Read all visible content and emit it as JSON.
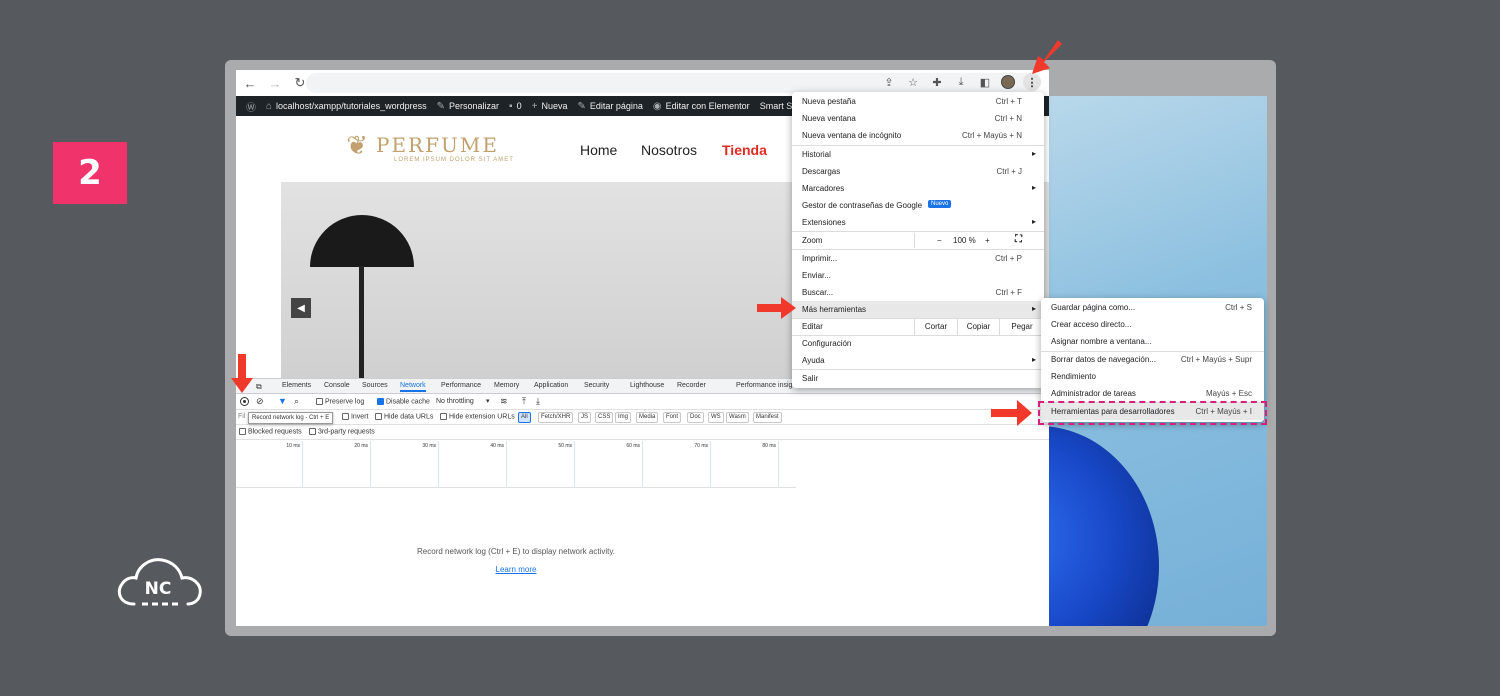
{
  "step_number": "2",
  "brand_logo": "NC",
  "browser": {
    "wp_admin_bar": {
      "site": "localhost/xampp/tutoriales_wordpress",
      "customize": "Personalizar",
      "comments": "0",
      "new": "Nueva",
      "edit_page": "Editar página",
      "edit_elementor": "Editar con Elementor",
      "truncated": "Smart Sl"
    },
    "site": {
      "logo_title": "PERFUME",
      "logo_subtitle": "LOREM IPSUM DOLOR SIT AMET",
      "menu": [
        "Home",
        "Nosotros",
        "Tienda"
      ],
      "active_menu_color": "#e02b20"
    },
    "devtools": {
      "tabs": [
        "Elements",
        "Console",
        "Sources",
        "Network",
        "Performance",
        "Memory",
        "Application",
        "Security",
        "Lighthouse",
        "Recorder",
        "Performance insig"
      ],
      "active_tab": "Network",
      "preserve_log": "Preserve log",
      "disable_cache": "Disable cache",
      "throttling": "No throttling",
      "filter_placeholder": "Fil",
      "invert": "Invert",
      "hide_data_urls": "Hide data URLs",
      "hide_extension_urls": "Hide extension URLs",
      "type_filters": [
        "All",
        "Fetch/XHR",
        "JS",
        "CSS",
        "Img",
        "Media",
        "Font",
        "Doc",
        "WS",
        "Wasm",
        "Manifest"
      ],
      "blocked_requests": "Blocked requests",
      "third_party": "3rd-party requests",
      "tooltip": "Record network log - Ctrl + E",
      "timeline_ticks": [
        "10 ms",
        "20 ms",
        "30 ms",
        "40 ms",
        "50 ms",
        "60 ms",
        "70 ms",
        "80 ms"
      ],
      "empty_message": "Record network log (Ctrl + E) to display network activity.",
      "learn_more": "Learn more"
    }
  },
  "chrome_menu": {
    "items": [
      {
        "label": "Nueva pestaña",
        "shortcut": "Ctrl + T"
      },
      {
        "label": "Nueva ventana",
        "shortcut": "Ctrl + N"
      },
      {
        "label": "Nueva ventana de incógnito",
        "shortcut": "Ctrl + Mayús + N"
      },
      {
        "label": "Historial",
        "shortcut": ""
      },
      {
        "label": "Descargas",
        "shortcut": "Ctrl + J"
      },
      {
        "label": "Marcadores",
        "shortcut": ""
      },
      {
        "label": "Gestor de contraseñas de Google",
        "shortcut": ""
      },
      {
        "label": "Extensiones",
        "shortcut": ""
      },
      {
        "label": "Zoom",
        "shortcut": ""
      },
      {
        "label": "Imprimir...",
        "shortcut": "Ctrl + P"
      },
      {
        "label": "Enviar...",
        "shortcut": ""
      },
      {
        "label": "Buscar...",
        "shortcut": "Ctrl + F"
      },
      {
        "label": "Más herramientas",
        "shortcut": ""
      },
      {
        "label": "Editar",
        "shortcut": ""
      },
      {
        "label": "Configuración",
        "shortcut": ""
      },
      {
        "label": "Ayuda",
        "shortcut": ""
      },
      {
        "label": "Salir",
        "shortcut": ""
      }
    ],
    "new_badge": "Nuevo",
    "zoom_minus": "−",
    "zoom_value": "100 %",
    "zoom_plus": "+",
    "edit_cut": "Cortar",
    "edit_copy": "Copiar",
    "edit_paste": "Pegar"
  },
  "sub_menu": {
    "items": [
      {
        "label": "Guardar página como...",
        "shortcut": "Ctrl + S"
      },
      {
        "label": "Crear acceso directo...",
        "shortcut": ""
      },
      {
        "label": "Asignar nombre a ventana...",
        "shortcut": ""
      },
      {
        "label": "Borrar datos de navegación...",
        "shortcut": "Ctrl + Mayús + Supr"
      },
      {
        "label": "Rendimiento",
        "shortcut": ""
      },
      {
        "label": "Administrador de tareas",
        "shortcut": "Mayús + Esc"
      },
      {
        "label": "Herramientas para desarrolladores",
        "shortcut": "Ctrl + Mayús + I"
      }
    ]
  },
  "colors": {
    "background": "#565a5f",
    "badge": "#f0336a",
    "arrow": "#f0392b",
    "highlight_dash": "#d6207c"
  }
}
